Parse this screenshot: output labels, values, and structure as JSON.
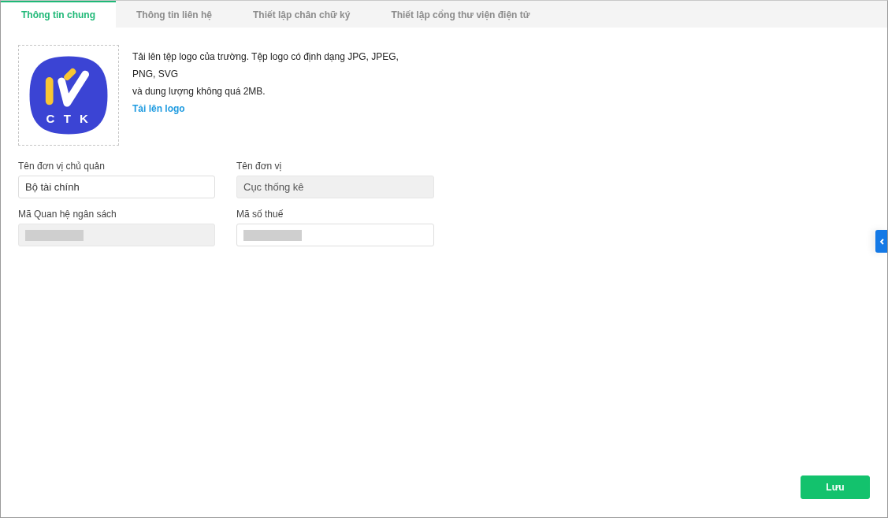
{
  "tabs": [
    {
      "label": "Thông tin chung",
      "selected": true
    },
    {
      "label": "Thông tin liên hệ",
      "selected": false
    },
    {
      "label": "Thiết lập chân chữ ký",
      "selected": false
    },
    {
      "label": "Thiết lập cổng thư viện điện tử",
      "selected": false
    }
  ],
  "logo_upload": {
    "logo_text": "C T K",
    "description_lines": [
      "Tải lên tệp logo của trường. Tệp logo có định dạng JPG, JPEG,",
      "PNG, SVG",
      "và dung lượng không quá 2MB."
    ],
    "upload_link": "Tải lên logo"
  },
  "fields": [
    {
      "label": "Tên đơn vị chủ quản",
      "value": "Bộ tài chính",
      "disabled": false
    },
    {
      "label": "Tên đơn vị",
      "value": "Cục thống kê",
      "disabled": true
    },
    {
      "label": "Mã Quan hệ ngân sách",
      "disabled": true,
      "redacted": true
    },
    {
      "label": "Mã số thuế",
      "disabled": false,
      "redacted": true
    }
  ],
  "side_toggle": {
    "expanded": false
  },
  "buttons": [
    {
      "label": "Lưu",
      "kind": "primary"
    }
  ]
}
